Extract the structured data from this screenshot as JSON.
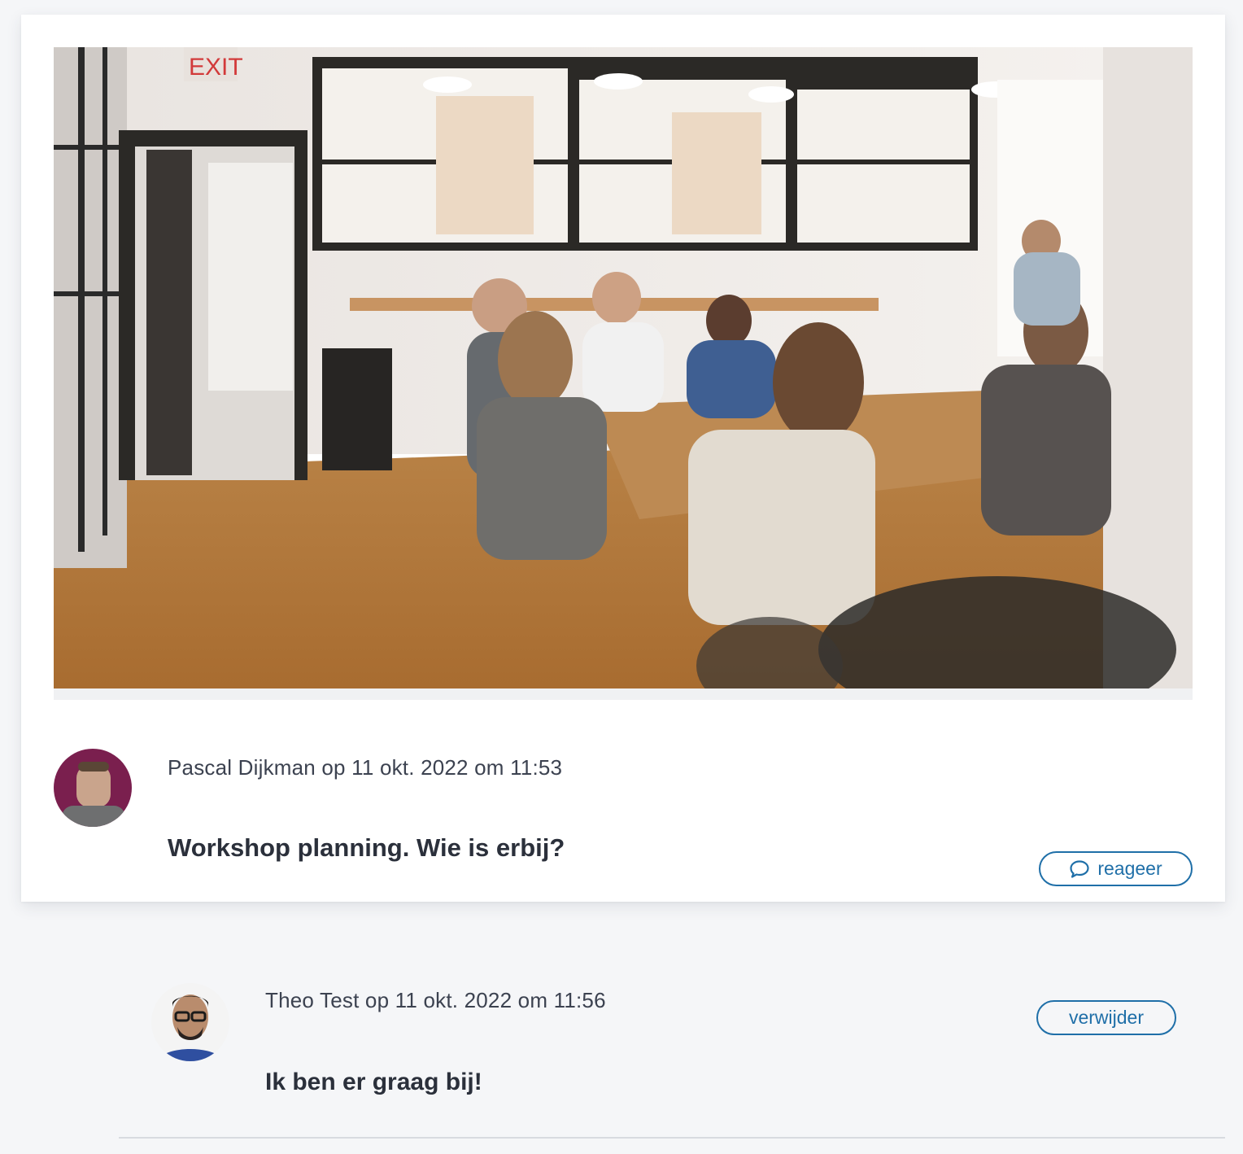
{
  "post": {
    "photo_icon": "group-meeting-photo",
    "author_avatar_icon": "avatar-pascal",
    "meta": "Pascal Dijkman op 11 okt. 2022 om 11:53",
    "text": "Workshop planning. Wie is erbij?",
    "reply_icon": "speech-bubble-icon",
    "reply_label": "reageer"
  },
  "comment": {
    "author_avatar_icon": "avatar-theo",
    "meta": "Theo Test op 11 okt. 2022 om 11:56",
    "text": "Ik ben er graag bij!",
    "delete_label": "verwijder"
  },
  "colors": {
    "accent": "#1f6fa8",
    "background": "#f5f6f8",
    "card": "#ffffff",
    "text": "#2b303b"
  }
}
